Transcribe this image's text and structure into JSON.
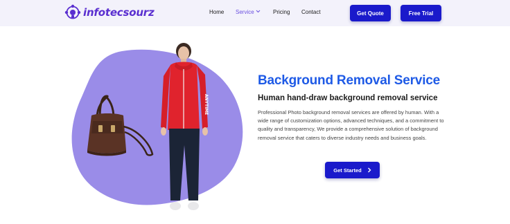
{
  "brand": {
    "name": "infotecsourz",
    "color": "#5a2fd0"
  },
  "nav": {
    "home": "Home",
    "service": "Service",
    "pricing": "Pricing",
    "contact": "Contact"
  },
  "header_buttons": {
    "quote": "Get Quote",
    "trial": "Free Trial"
  },
  "hero": {
    "title": "Background Removal Service",
    "subtitle": "Human hand-draw background removal service",
    "description": "Professional Photo background removal services are offered by human. With a wide range of customization options, advanced techniques, and a commitment to quality and transparency, We provide a comprehensive solution of background removal service that caters to diverse industry needs and business goals.",
    "cta": "Get Started",
    "jacket_print": "ANYTIME"
  },
  "colors": {
    "accent": "#1a1acb",
    "title_blue": "#1e5ae6",
    "blob": "#9a8ce8",
    "header_bg": "#f3f2fb"
  },
  "icons": {
    "logo": "lightbulb-network-icon",
    "service_dropdown": "chevron-down-icon",
    "cta_arrow": "chevron-right-icon"
  }
}
